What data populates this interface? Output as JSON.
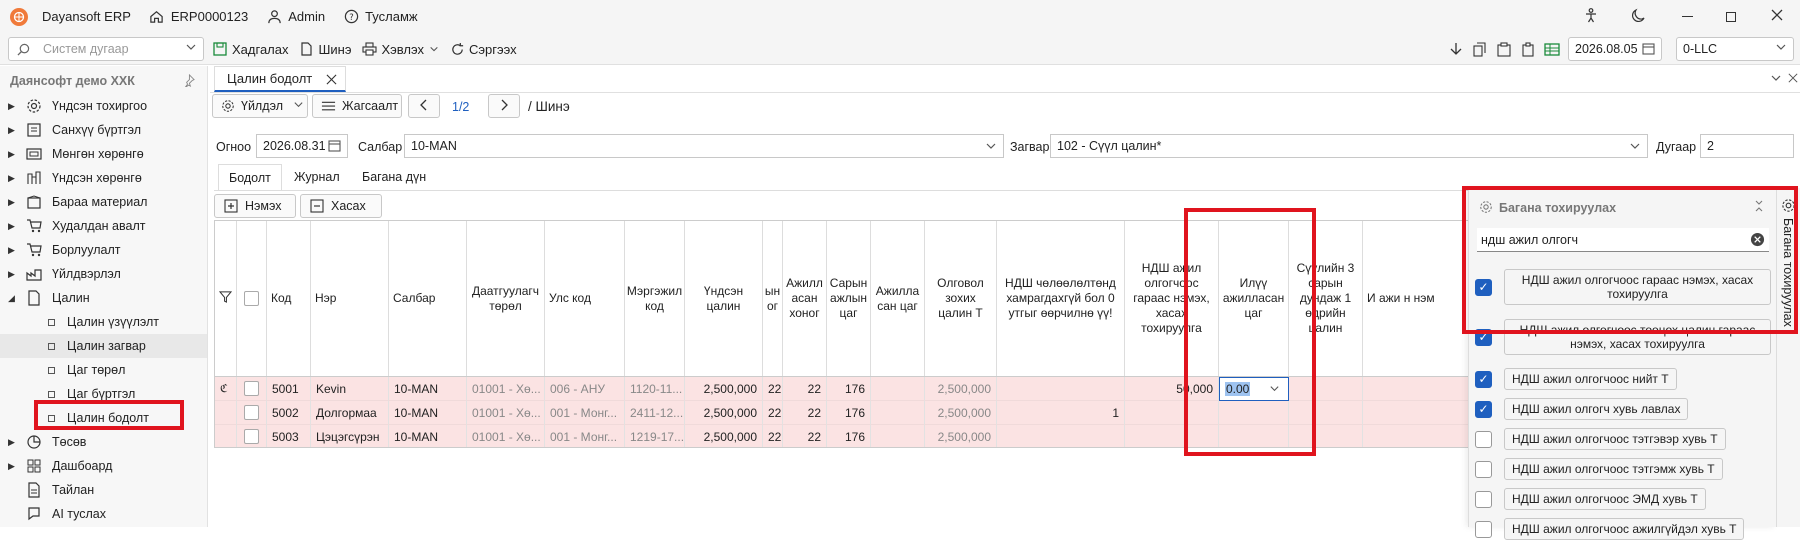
{
  "titlebar": {
    "app": "Dayansoft ERP",
    "erp_id": "ERP0000123",
    "user": "Admin",
    "help": "Тусламж"
  },
  "toolbar": {
    "search_placeholder": "Систем дугаар",
    "save": "Хадгалах",
    "new": "Шинэ",
    "print": "Хэвлэх",
    "refresh": "Сэргээх",
    "date": "2026.08.05",
    "company_code": "0-LLC"
  },
  "sidebar": {
    "company": "Даянсофт демо ХХК",
    "items": [
      {
        "label": "Үндсэн тохиргоо",
        "icon": "gear-icon"
      },
      {
        "label": "Санхүү бүртгэл",
        "icon": "ledger-icon"
      },
      {
        "label": "Мөнгөн хөрөнгө",
        "icon": "cash-icon"
      },
      {
        "label": "Үндсэн хөрөнгө",
        "icon": "asset-icon"
      },
      {
        "label": "Бараа материал",
        "icon": "box-icon"
      },
      {
        "label": "Худалдан авалт",
        "icon": "cart-icon"
      },
      {
        "label": "Борлуулалт",
        "icon": "cart-icon"
      },
      {
        "label": "Үйлдвэрлэл",
        "icon": "factory-icon"
      },
      {
        "label": "Цалин",
        "icon": "document-icon"
      }
    ],
    "subitems": [
      "Цалин үзүүлэлт",
      "Цалин загвар",
      "Цаг төрөл",
      "Цаг бүртгэл",
      "Цалин бодолт"
    ],
    "items_after": [
      {
        "label": "Төсөв",
        "icon": "pie-icon"
      },
      {
        "label": "Дашбоард",
        "icon": "dashboard-icon"
      },
      {
        "label": "Тайлан",
        "icon": "report-icon"
      },
      {
        "label": "AI туслах",
        "icon": "ai-icon"
      }
    ]
  },
  "main": {
    "doc_tab": "Цалин бодолт",
    "actions": "Үйлдэл",
    "list": "Жагсаалт",
    "pager": "1/2",
    "mode": "/ Шинэ",
    "date_label": "Огноо",
    "date": "2026.08.31",
    "branch_label": "Салбар",
    "branch": "10-MAN",
    "template_label": "Загвар",
    "template": "102 - Сүүл цалин*",
    "number_label": "Дугаар",
    "number": "2",
    "subtabs": [
      "Бодолт",
      "Журнал",
      "Багана дүн"
    ],
    "add": "Нэмэх",
    "remove": "Хасах"
  },
  "grid": {
    "headers": {
      "code": "Код",
      "name": "Нэр",
      "branch": "Салбар",
      "insurer_type": "Даатгуулагч төрөл",
      "country": "Улс код",
      "profession": "Мэргэжил код",
      "base_salary": "Үндсэн цалин",
      "c1": "ын ог",
      "worked_days": "Ажилл асан хоног",
      "month_hours": "Сарын ажлын цаг",
      "worked_hours": "Ажилла сан цаг",
      "accrued": "Олговол зохих цалин Т",
      "exempt": "НДШ чөлөөлөлтөнд хамрагдахгүй бол 0 утгыг өөрчилнө үү!",
      "ndsh_adj": "НДШ ажил олгогчоос гараас нэмэх, хасах тохируулга",
      "overtime": "Илүү ажилласан цаг",
      "avg3": "Сүүлийн 3 сарын дундаж 1 өдрийн цалин",
      "c2": "И ажи н нэм"
    },
    "rows": [
      {
        "code": "5001",
        "name": "Kevin",
        "branch": "10-MAN",
        "insurer": "01001 - Хө...",
        "country": "006 - АНУ",
        "prof": "1120-11...",
        "base": "2,500,000",
        "c1": "22",
        "days": "22",
        "hours": "176",
        "accrued": "2,500,000",
        "ndsh": "50,000",
        "overtime": "0.00"
      },
      {
        "code": "5002",
        "name": "Долгормаа",
        "branch": "10-MAN",
        "insurer": "01001 - Хө...",
        "country": "001 - Монг...",
        "prof": "2411-12...",
        "base": "2,500,000",
        "c1": "22",
        "days": "22",
        "hours": "176",
        "accrued": "2,500,000",
        "exempt": "1",
        "ndsh": "",
        "overtime": ""
      },
      {
        "code": "5003",
        "name": "Цэцэгсүрэн",
        "branch": "10-MAN",
        "insurer": "01001 - Хө...",
        "country": "001 - Монг...",
        "prof": "1219-17...",
        "base": "2,500,000",
        "c1": "22",
        "days": "22",
        "hours": "176",
        "accrued": "2,500,000",
        "ndsh": "",
        "overtime": ""
      }
    ]
  },
  "panel": {
    "title": "Багана тохируулах",
    "search": "ндш ажил олгогч",
    "vertical_tab": "Багана тохируулах",
    "items": [
      {
        "label": "НДШ ажил олгогчоос гараас нэмэх, хасах тохируулга",
        "checked": true
      },
      {
        "label": "НДШ ажил олгогчоос тооцох цалин гараас нэмэх, хасах тохируулга",
        "checked": true
      },
      {
        "label": "НДШ ажил олгогчоос нийт Т",
        "checked": true
      },
      {
        "label": "НДШ ажил олгогч хувь лавлах",
        "checked": true
      },
      {
        "label": "НДШ ажил олгогчоос тэтгэвэр хувь Т",
        "checked": false
      },
      {
        "label": "НДШ ажил олгогчоос тэтгэмж хувь Т",
        "checked": false
      },
      {
        "label": "НДШ ажил олгогчоос ЭМД хувь Т",
        "checked": false
      },
      {
        "label": "НДШ ажил олгогчоос ажилгүйдэл хувь Т",
        "checked": false
      }
    ]
  },
  "colors": {
    "accent": "#1f5fbf",
    "highlight": "#e0141e",
    "row_bg": "#fbe3e3",
    "logo": "#f07a3a"
  }
}
